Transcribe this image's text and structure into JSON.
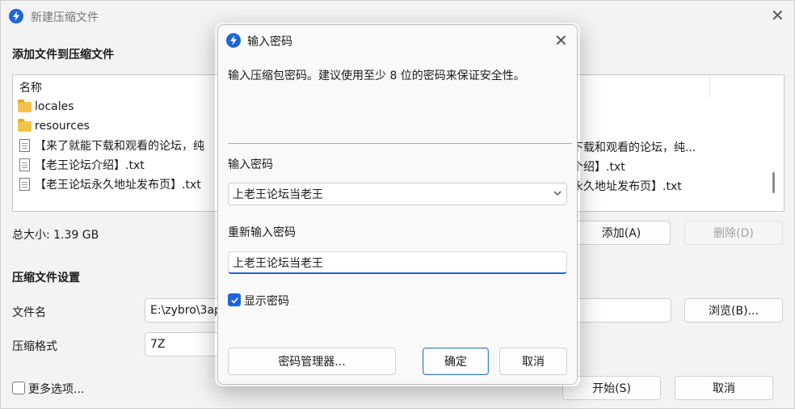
{
  "main": {
    "title": "新建压缩文件",
    "add_section_title": "添加文件到压缩文件",
    "list_header": "名称",
    "files": [
      {
        "name": "locales",
        "kind": "folder"
      },
      {
        "name": "resources",
        "kind": "folder"
      },
      {
        "name": "【来了就能下载和观看的论坛，纯",
        "kind": "file"
      },
      {
        "name": "【老王论坛介绍】.txt",
        "kind": "file"
      },
      {
        "name": "【老王论坛永久地址发布页】.txt",
        "kind": "file"
      }
    ],
    "right_column": [
      "下载和观看的论坛，纯...",
      "个绍】.txt",
      "永久地址发布页】.txt"
    ],
    "total_size": "总大小: 1.39 GB",
    "add_button": "添加(A)",
    "delete_button": "删除(D)",
    "settings_title": "压缩文件设置",
    "filename_label": "文件名",
    "filename_value": "E:\\zybro\\3ap",
    "browse_button": "浏览(B)...",
    "format_label": "压缩格式",
    "format_value": "7Z",
    "more_options": "更多选项...",
    "start_button": "开始(S)",
    "cancel_button": "取消"
  },
  "dialog": {
    "title": "输入密码",
    "description": "输入压缩包密码。建议使用至少 8 位的密码来保证安全性。",
    "password_label": "输入密码",
    "password_value": "上老王论坛当老王",
    "reenter_label": "重新输入密码",
    "reenter_value": "上老王论坛当老王",
    "show_password_label": "显示密码",
    "show_password_checked": true,
    "manager_button": "密码管理器...",
    "ok_button": "确定",
    "cancel_button": "取消"
  },
  "colors": {
    "accent": "#1d66d6",
    "background": "#f3f3f3",
    "folder": "#f3c24d"
  },
  "icons": [
    "app-icon",
    "close-icon",
    "folder-icon",
    "file-icon",
    "chevron-down-icon",
    "checkmark-icon"
  ]
}
